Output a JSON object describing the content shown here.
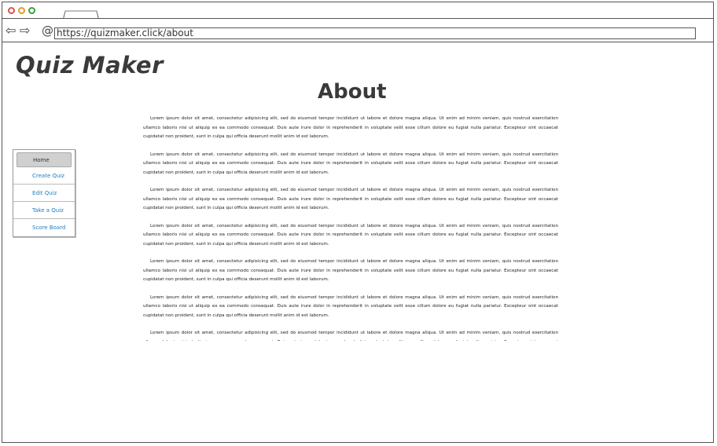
{
  "browser": {
    "url": "https://quizmaker.click/about"
  },
  "app": {
    "logo": "Quiz Maker"
  },
  "sidebar": {
    "items": [
      {
        "label": "Home"
      },
      {
        "label": "Create Quiz"
      },
      {
        "label": "Edit Quiz"
      },
      {
        "label": "Take a Quiz"
      },
      {
        "label": "Score Board"
      }
    ]
  },
  "main": {
    "title": "About",
    "paragraphs": [
      "Lorem ipsum dolor sit amet, consectetur adipisicing elit, sed do eiusmod tempor incididunt ut labore et dolore magna aliqua. Ut enim ad minim veniam, quis nostrud exercitation ullamco laboris nisi ut aliquip ex ea commodo consequat. Duis aute irure dolor in reprehenderit in voluptate velit esse cillum dolore eu fugiat nulla pariatur. Excepteur sint occaecat cupidatat non proident, sunt in culpa qui officia deserunt mollit anim id est laborum.",
      "Lorem ipsum dolor sit amet, consectetur adipisicing elit, sed do eiusmod tempor incididunt ut labore et dolore magna aliqua. Ut enim ad minim veniam, quis nostrud exercitation ullamco laboris nisi ut aliquip ex ea commodo consequat. Duis aute irure dolor in reprehenderit in voluptate velit esse cillum dolore eu fugiat nulla pariatur. Excepteur sint occaecat cupidatat non proident, sunt in culpa qui officia deserunt mollit anim id est laborum.",
      "Lorem ipsum dolor sit amet, consectetur adipisicing elit, sed do eiusmod tempor incididunt ut labore et dolore magna aliqua. Ut enim ad minim veniam, quis nostrud exercitation ullamco laboris nisi ut aliquip ex ea commodo consequat. Duis aute irure dolor in reprehenderit in voluptate velit esse cillum dolore eu fugiat nulla pariatur. Excepteur sint occaecat cupidatat non proident, sunt in culpa qui officia deserunt mollit anim id est laborum.",
      "Lorem ipsum dolor sit amet, consectetur adipisicing elit, sed do eiusmod tempor incididunt ut labore et dolore magna aliqua. Ut enim ad minim veniam, quis nostrud exercitation ullamco laboris nisi ut aliquip ex ea commodo consequat. Duis aute irure dolor in reprehenderit in voluptate velit esse cillum dolore eu fugiat nulla pariatur. Excepteur sint occaecat cupidatat non proident, sunt in culpa qui officia deserunt mollit anim id est laborum.",
      "Lorem ipsum dolor sit amet, consectetur adipisicing elit, sed do eiusmod tempor incididunt ut labore et dolore magna aliqua. Ut enim ad minim veniam, quis nostrud exercitation ullamco laboris nisi ut aliquip ex ea commodo consequat. Duis aute irure dolor in reprehenderit in voluptate velit esse cillum dolore eu fugiat nulla pariatur. Excepteur sint occaecat cupidatat non proident, sunt in culpa qui officia deserunt mollit anim id est laborum.",
      "Lorem ipsum dolor sit amet, consectetur adipisicing elit, sed do eiusmod tempor incididunt ut labore et dolore magna aliqua. Ut enim ad minim veniam, quis nostrud exercitation ullamco laboris nisi ut aliquip ex ea commodo consequat. Duis aute irure dolor in reprehenderit in voluptate velit esse cillum dolore eu fugiat nulla pariatur. Excepteur sint occaecat cupidatat non proident, sunt in culpa qui officia deserunt mollit anim id est laborum.",
      "Lorem ipsum dolor sit amet, consectetur adipisicing elit, sed do eiusmod tempor incididunt ut labore et dolore magna aliqua. Ut enim ad minim veniam, quis nostrud exercitation ullamco laboris nisi ut aliquip ex ea commodo consequat. Duis aute irure dolor in reprehenderit in voluptate velit esse cillum dolore eu fugiat nulla pariatur. Excepteur sint occaecat cupidatat non proident, sunt in culpa qui officia deserunt mollit anim id est laborum."
    ]
  },
  "colors": {
    "link": "#1f7fbf",
    "active_item_bg": "#d0d0d0",
    "close_dot": "#d9534f",
    "minimize_dot": "#e0a020",
    "maximize_dot": "#3ca03c"
  },
  "icons": {
    "back": "back-arrow-icon",
    "forward": "forward-arrow-icon",
    "address": "at-sign-icon"
  }
}
